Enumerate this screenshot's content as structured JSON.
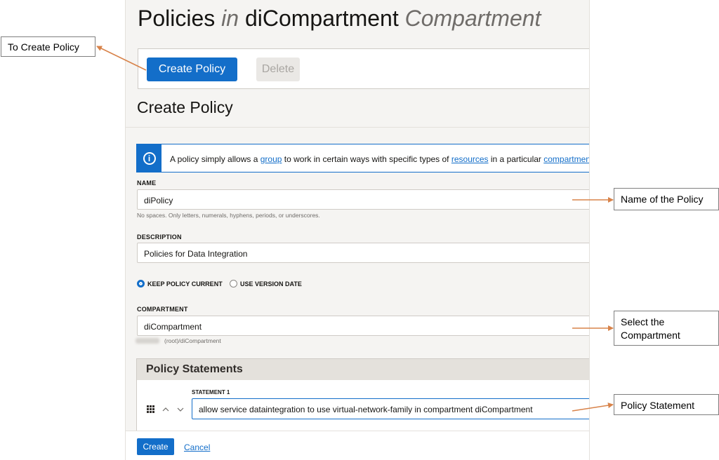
{
  "page": {
    "title_prefix": "Policies",
    "title_in": "in",
    "title_name": "diCompartment",
    "title_suffix": "Compartment"
  },
  "toolbar": {
    "create_label": "Create Policy",
    "delete_label": "Delete"
  },
  "panel": {
    "title": "Create Policy",
    "info": {
      "text_1": "A policy simply allows a ",
      "link_group": "group",
      "text_2": " to work in certain ways with specific types of ",
      "link_resources": "resources",
      "text_3": " in a particular ",
      "link_compartment": "compartment."
    },
    "name": {
      "label": "NAME",
      "value": "diPolicy",
      "hint": "No spaces. Only letters, numerals, hyphens, periods, or underscores."
    },
    "description": {
      "label": "DESCRIPTION",
      "value": "Policies for Data Integration"
    },
    "versioning": {
      "keep_current": "KEEP POLICY CURRENT",
      "use_version_date": "USE VERSION DATE",
      "selected": "KEEP POLICY CURRENT"
    },
    "compartment": {
      "label": "COMPARTMENT",
      "value": "diCompartment",
      "path": "(root)/diCompartment"
    },
    "statements": {
      "header": "Policy Statements",
      "items": [
        {
          "label": "STATEMENT 1",
          "value": "allow service dataintegration to use virtual-network-family in compartment diCompartment"
        }
      ]
    },
    "footer": {
      "create_label": "Create",
      "cancel_label": "Cancel"
    }
  },
  "annotations": {
    "create_policy": "To Create Policy",
    "name": "Name of the Policy",
    "compartment": "Select the Compartment",
    "statement": "Policy Statement",
    "arrow_color": "#d8834a"
  },
  "colors": {
    "accent": "#136ec9",
    "background": "#f5f4f2"
  }
}
